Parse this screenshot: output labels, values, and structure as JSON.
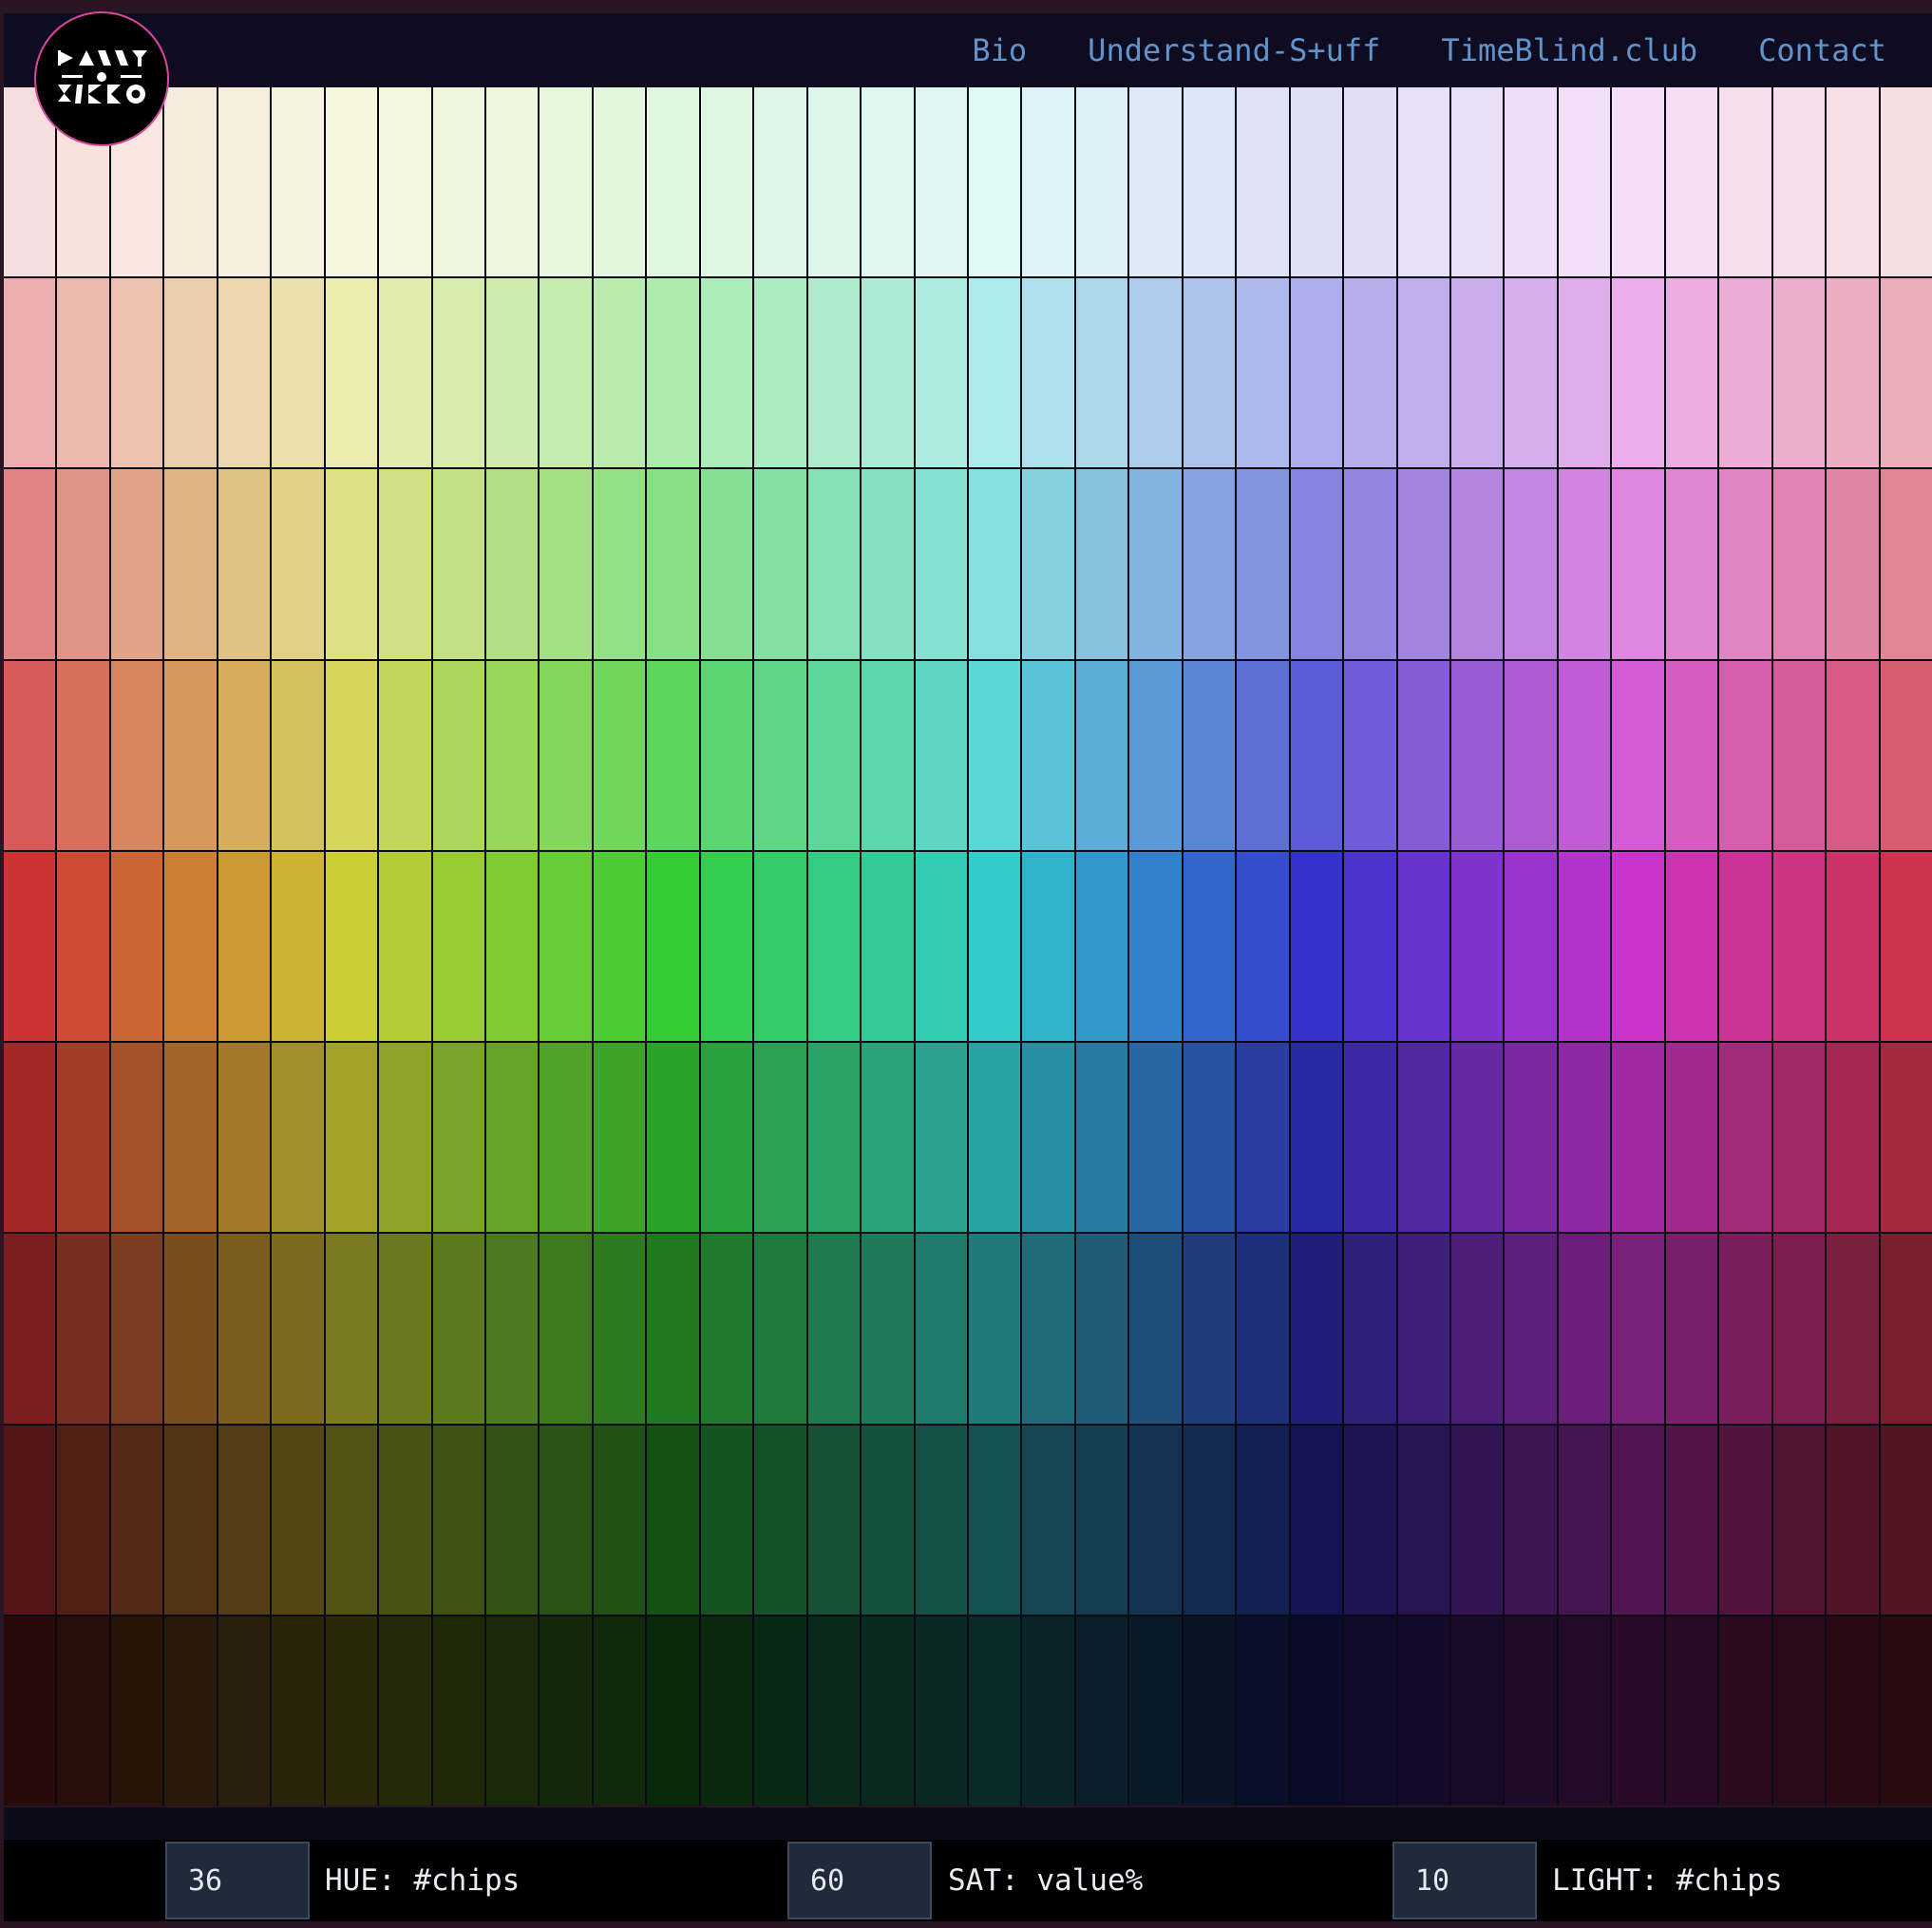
{
  "nav": {
    "links": [
      "Bio",
      "Understand-S+uff",
      "TimeBlind.club",
      "Contact"
    ]
  },
  "logo": {
    "text": "DANNY CISCO",
    "icon": "danny-cisco-logo-icon",
    "border_color": "#d9479a"
  },
  "palette": {
    "hue_columns": 36,
    "lightness_rows": 9,
    "hue_step_degrees": 10,
    "saturation_percent": 60,
    "lightness_percent_rows": [
      92,
      80,
      70,
      60,
      50,
      40,
      30,
      20,
      10
    ]
  },
  "controls": {
    "hue": {
      "value": "36",
      "label": "HUE: #chips"
    },
    "sat": {
      "value": "60",
      "label": "SAT: value%"
    },
    "light": {
      "value": "10",
      "label": "LIGHT: #chips"
    }
  },
  "colors": {
    "background": "#2a1525",
    "nav_bg": "#0f0c22",
    "nav_link": "#5f95cc",
    "controls_bg": "#000000",
    "input_bg": "#1f2a3a"
  }
}
